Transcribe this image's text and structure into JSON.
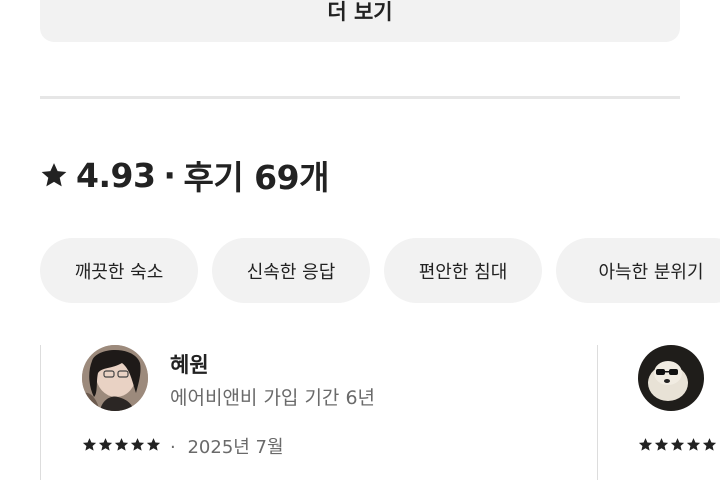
{
  "more_button": {
    "label": "더 보기"
  },
  "rating": {
    "score": "4.93",
    "separator": "·",
    "reviews_label": "후기 69개"
  },
  "chips": [
    {
      "label": "깨끗한 숙소"
    },
    {
      "label": "신속한 응답"
    },
    {
      "label": "편안한 침대"
    },
    {
      "label": "아늑한 분위기"
    }
  ],
  "reviews": [
    {
      "name": "혜원",
      "member_since": "에어비앤비 가입 기간 6년",
      "stars": 5,
      "date_prefix": "·",
      "date": "2025년 7월"
    },
    {
      "stars": 5
    }
  ],
  "colors": {
    "text": "#222222",
    "muted": "#6a6a6a",
    "chip_bg": "#f2f2f2",
    "divider": "#e6e6e6"
  }
}
